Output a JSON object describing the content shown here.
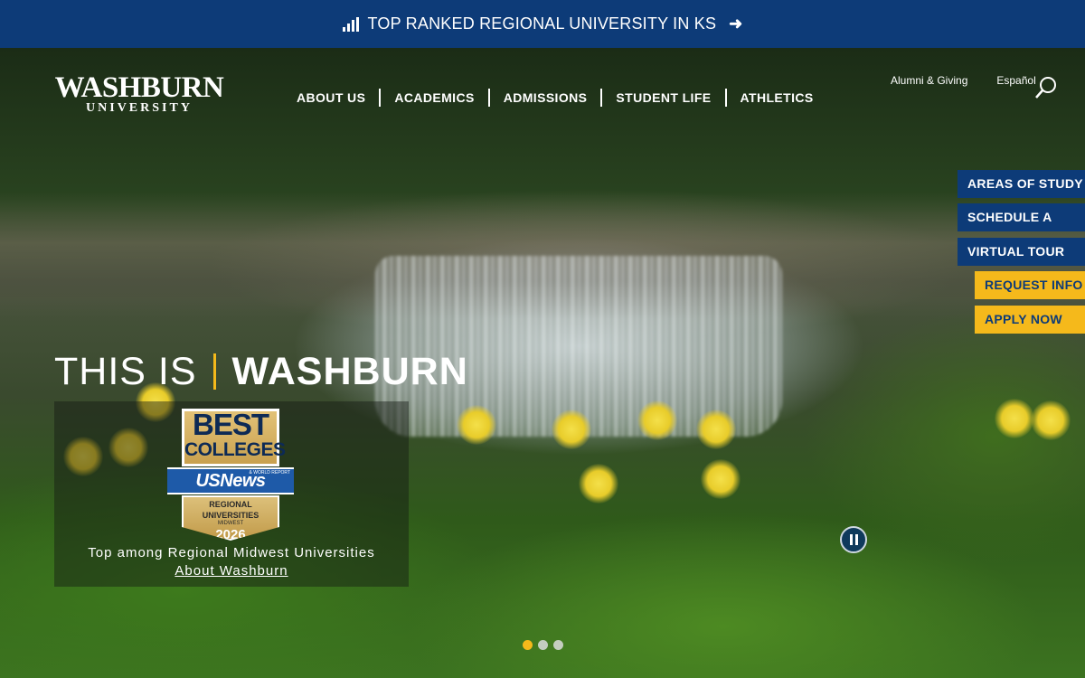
{
  "top_banner": {
    "text": "TOP RANKED REGIONAL UNIVERSITY IN KS",
    "icon": "bar-chart-icon",
    "arrow_icon": "arrow-right-icon"
  },
  "logo": {
    "main": "WASHBURN",
    "sub": "UNIVERSITY"
  },
  "main_nav": [
    {
      "label": "ABOUT US"
    },
    {
      "label": "ACADEMICS"
    },
    {
      "label": "ADMISSIONS"
    },
    {
      "label": "STUDENT LIFE"
    },
    {
      "label": "ATHLETICS"
    }
  ],
  "utility_nav": [
    {
      "label": "Alumni & Giving"
    },
    {
      "label": "Español"
    }
  ],
  "cta_buttons": [
    {
      "label": "AREAS OF STUDY",
      "style": "blue"
    },
    {
      "label": "SCHEDULE A VISIT",
      "style": "blue"
    },
    {
      "label": "VIRTUAL TOUR",
      "style": "blue"
    },
    {
      "label": "REQUEST INFO",
      "style": "gold"
    },
    {
      "label": "APPLY NOW",
      "style": "gold"
    }
  ],
  "hero": {
    "tagline_part1": "THIS IS",
    "tagline_part2": "WASHBURN",
    "badge": {
      "line1": "BEST",
      "line2": "COLLEGES",
      "brand": "USNews",
      "brand_sub": "& WORLD REPORT",
      "category": "REGIONAL UNIVERSITIES",
      "region": "MIDWEST",
      "year": "2026"
    },
    "card_text": "Top among Regional Midwest Universities",
    "card_link": "About Washburn"
  },
  "carousel": {
    "slide_count": 3,
    "active_slide": 1
  },
  "colors": {
    "brand_blue": "#0d3b78",
    "brand_gold": "#f5b91b"
  }
}
